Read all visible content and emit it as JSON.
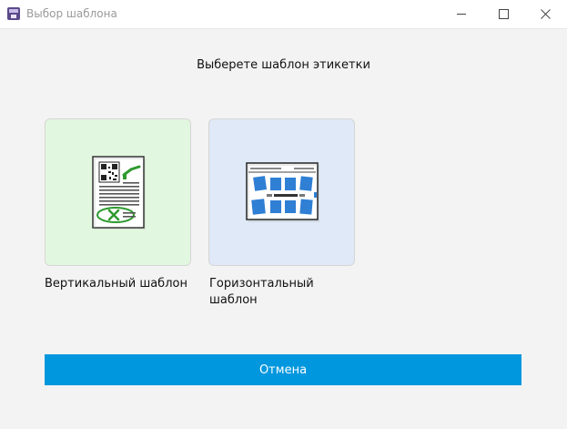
{
  "window": {
    "title": "Выбор шаблона",
    "icon": "app-icon",
    "controls": [
      "minimize",
      "maximize",
      "close"
    ]
  },
  "heading": "Выберете шаблон этикетки",
  "templates": [
    {
      "label": "Вертикальный шаблон",
      "icon": "vertical-label-template-icon",
      "bg": "#e2f7df"
    },
    {
      "label": "Горизонтальный шаблон",
      "icon": "horizontal-label-template-icon",
      "bg": "#dfe9f7"
    }
  ],
  "cancel_button": {
    "label": "Отмена",
    "color": "#0097de"
  }
}
